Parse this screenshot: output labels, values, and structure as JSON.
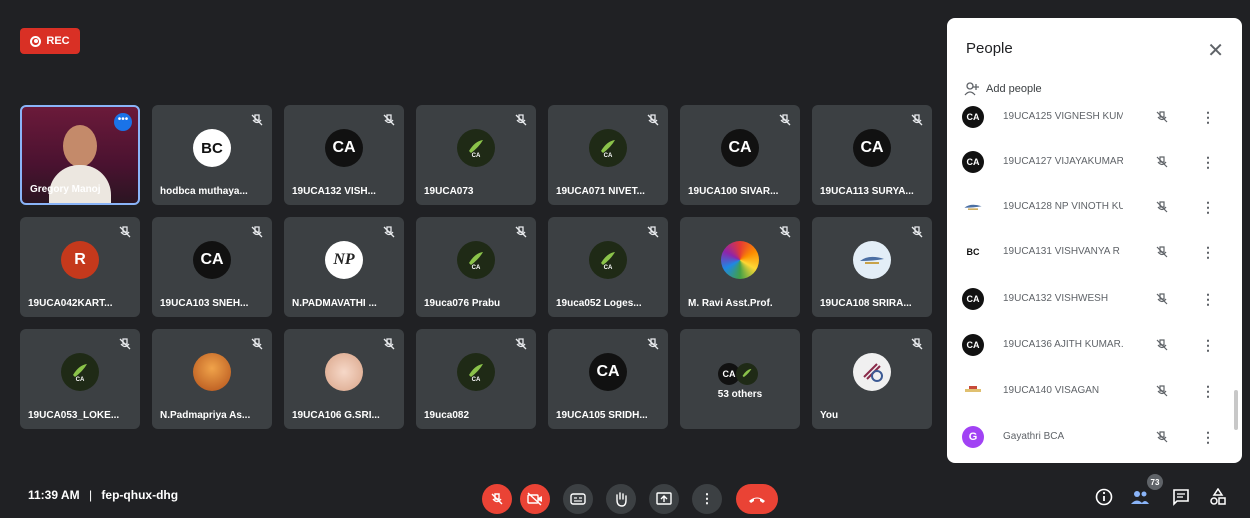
{
  "recording": {
    "label": "REC",
    "color": "#d93025"
  },
  "tiles": [
    {
      "name": "Gregory Manoj",
      "avatar": "self-video"
    },
    {
      "name": "hodbca muthaya...",
      "avatar": "BC"
    },
    {
      "name": "19UCA132 VISH...",
      "avatar": "CA"
    },
    {
      "name": "19UCA073",
      "avatar": "leaf"
    },
    {
      "name": "19UCA071 NIVET...",
      "avatar": "leaf"
    },
    {
      "name": "19UCA100 SIVAR...",
      "avatar": "CA"
    },
    {
      "name": "19UCA113 SURYA...",
      "avatar": "CA"
    },
    {
      "name": "19UCA042KART...",
      "avatar": "R"
    },
    {
      "name": "19UCA103 SNEH...",
      "avatar": "CA"
    },
    {
      "name": "N.PADMAVATHI ...",
      "avatar": "NP"
    },
    {
      "name": "19uca076 Prabu",
      "avatar": "leaf"
    },
    {
      "name": "19uca052 Loges...",
      "avatar": "leaf"
    },
    {
      "name": "M. Ravi Asst.Prof.",
      "avatar": "color-wheel"
    },
    {
      "name": "19UCA108 SRIRA...",
      "avatar": "logo"
    },
    {
      "name": "19UCA053_LOKE...",
      "avatar": "leaf"
    },
    {
      "name": "N.Padmapriya As...",
      "avatar": "photo"
    },
    {
      "name": "19UCA106 G.SRI...",
      "avatar": "photo"
    },
    {
      "name": "19uca082",
      "avatar": "leaf"
    },
    {
      "name": "19UCA105 SRIDH...",
      "avatar": "CA"
    },
    {
      "name": "53 others",
      "avatar": "group"
    },
    {
      "name": "You",
      "avatar": "logo"
    }
  ],
  "avatar_text": {
    "ca": "CA",
    "bc": "BC",
    "r": "R",
    "np": "NP",
    "leaf": "CA"
  },
  "people_panel": {
    "title": "People",
    "add_people": "Add people",
    "participants": [
      {
        "name": "19UCA125 VIGNESH KUM...",
        "avatar": "CA",
        "color": "#111111"
      },
      {
        "name": "19UCA127 VIJAYAKUMAR K",
        "avatar": "CA",
        "color": "#111111"
      },
      {
        "name": "19UCA128 NP VINOTH KU...",
        "avatar": "logo",
        "color": "#6b8fb5"
      },
      {
        "name": "19UCA131 VISHVANYA R",
        "avatar": "BC",
        "color": "#ffffff"
      },
      {
        "name": "19UCA132 VISHWESH",
        "avatar": "CA",
        "color": "#111111"
      },
      {
        "name": "19UCA136 AJITH KUMAR.M",
        "avatar": "CA",
        "color": "#111111"
      },
      {
        "name": "19UCA140 VISAGAN",
        "avatar": "logo",
        "color": "#e0c070"
      },
      {
        "name": "Gayathri BCA",
        "avatar": "G",
        "color": "#a142f4"
      }
    ]
  },
  "bottom_bar": {
    "time": "11:39 AM",
    "separator": "|",
    "meeting_code": "fep-qhux-dhg",
    "participant_count": "73",
    "end_call_color": "#ea4335"
  },
  "icons": {
    "more": "more-dots-icon",
    "close": "close-icon",
    "mic_off": "mic-off-icon",
    "people": "people-icon",
    "chat": "chat-icon",
    "activities": "activities-icon",
    "info": "info-icon"
  }
}
